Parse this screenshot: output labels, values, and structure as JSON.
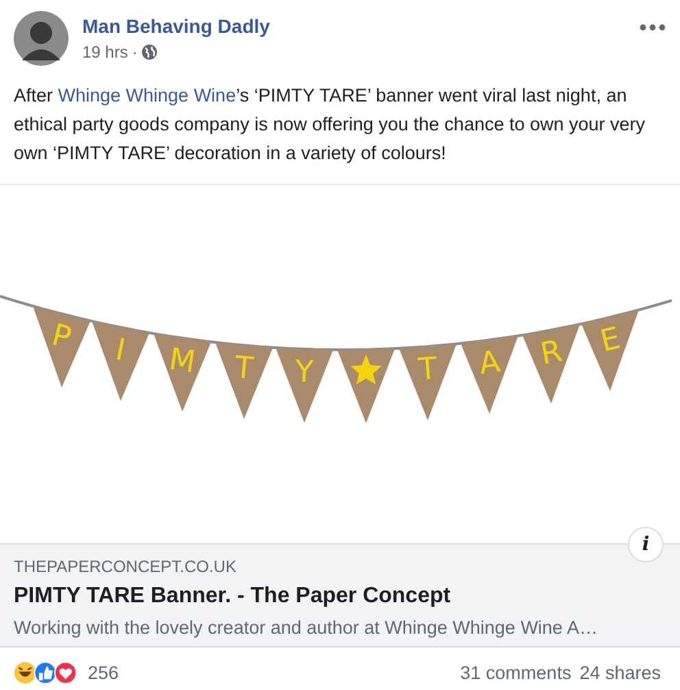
{
  "post": {
    "author": "Man Behaving Dadly",
    "time": "19 hrs",
    "separator": "·",
    "text_before": "After ",
    "mention": "Whinge Whinge Wine",
    "text_after": "’s ‘PIMTY TARE’ banner went viral last night, an ethical party goods company is now offering you the chance to own your very own ‘PIMTY TARE’ decoration in a variety of colours!"
  },
  "banner": {
    "flags": [
      {
        "kind": "letter",
        "text": "P"
      },
      {
        "kind": "letter",
        "text": "I"
      },
      {
        "kind": "letter",
        "text": "M"
      },
      {
        "kind": "letter",
        "text": "T"
      },
      {
        "kind": "letter",
        "text": "Y"
      },
      {
        "kind": "star"
      },
      {
        "kind": "letter",
        "text": "T"
      },
      {
        "kind": "letter",
        "text": "A"
      },
      {
        "kind": "letter",
        "text": "R"
      },
      {
        "kind": "letter",
        "text": "E"
      }
    ]
  },
  "link_preview": {
    "info_label": "i",
    "domain": "THEPAPERCONCEPT.CO.UK",
    "title": "PIMTY TARE Banner. - The Paper Concept",
    "description": "Working with the lovely creator and author at Whinge Whinge Wine A…"
  },
  "footer": {
    "reactions_count": "256",
    "comments": "31 comments",
    "shares": "24 shares"
  }
}
